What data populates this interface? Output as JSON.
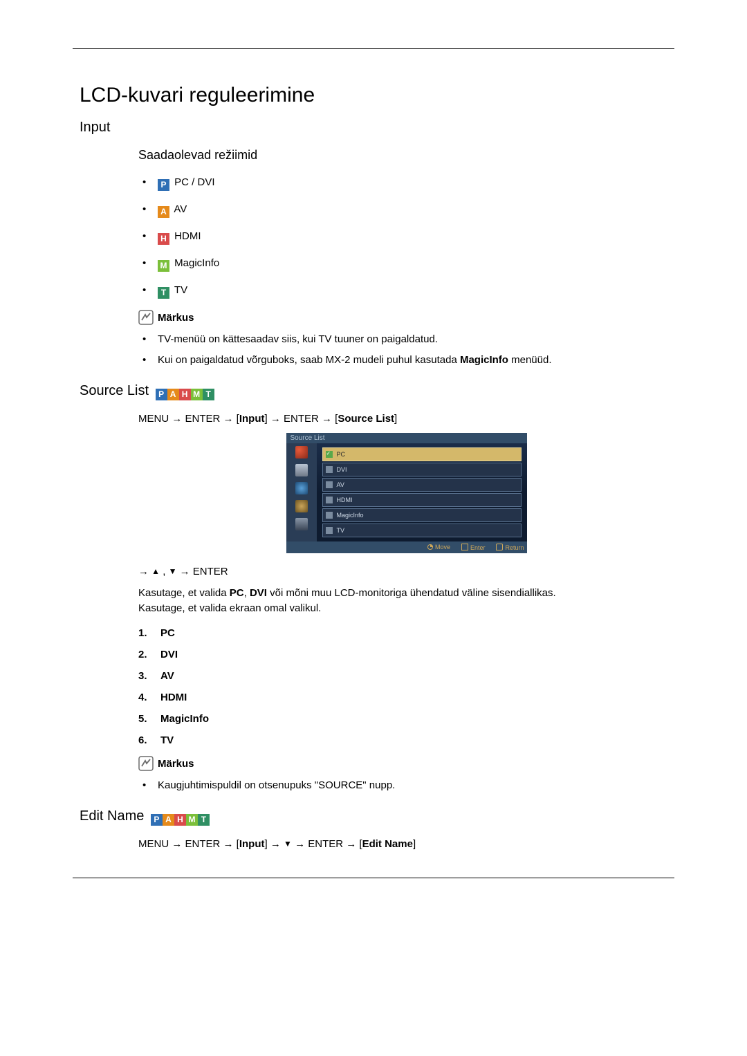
{
  "title": "LCD-kuvari reguleerimine",
  "sections": {
    "input": {
      "heading": "Input",
      "modes_heading": "Saadaolevad režiimid",
      "modes": [
        {
          "badge": "P",
          "label": "PC / DVI"
        },
        {
          "badge": "A",
          "label": "AV"
        },
        {
          "badge": "H",
          "label": "HDMI"
        },
        {
          "badge": "M",
          "label": "MagicInfo"
        },
        {
          "badge": "T",
          "label": "TV"
        }
      ],
      "note_label": "Märkus",
      "notes": [
        "TV-menüü on kättesaadav siis, kui TV tuuner on paigaldatud.",
        {
          "pre": "Kui on paigaldatud võrguboks, saab MX-2 mudeli puhul kasutada ",
          "bold": "MagicInfo",
          "post": " menüüd."
        }
      ]
    },
    "source_list": {
      "heading": "Source List",
      "badges": [
        "P",
        "A",
        "H",
        "M",
        "T"
      ],
      "path": {
        "p1": "MENU → ENTER → [",
        "b1": "Input",
        "p2": "] → ENTER → [",
        "b2": "Source List",
        "p3": "]"
      },
      "osd": {
        "title": "Source List",
        "items": [
          "PC",
          "DVI",
          "AV",
          "HDMI",
          "MagicInfo",
          "TV"
        ],
        "selected_index": 0,
        "footer": {
          "move": "Move",
          "enter": "Enter",
          "return": "Return"
        }
      },
      "nav_line": {
        "pre": "→ ",
        "up": "▲",
        "sep": " , ",
        "down": "▼",
        "post": " → ENTER"
      },
      "desc": {
        "l1_pre": "Kasutage, et valida ",
        "l1_b1": "PC",
        "l1_mid1": ", ",
        "l1_b2": "DVI",
        "l1_post": " või mõni muu LCD-monitoriga ühendatud väline sisendiallikas.",
        "l2": "Kasutage, et valida ekraan omal valikul."
      },
      "list": [
        "PC",
        "DVI",
        "AV",
        "HDMI",
        "MagicInfo",
        "TV"
      ],
      "note_label": "Märkus",
      "notes2": [
        "Kaugjuhtimispuldil on otsenupuks \"SOURCE\" nupp."
      ]
    },
    "edit_name": {
      "heading": "Edit Name",
      "badges": [
        "P",
        "A",
        "H",
        "M",
        "T"
      ],
      "path": {
        "p1": "MENU → ENTER → [",
        "b1": "Input",
        "p2": "] → ",
        "down": "▼",
        "p3": " → ENTER → [",
        "b2": "Edit Name",
        "p4": "]"
      }
    }
  }
}
